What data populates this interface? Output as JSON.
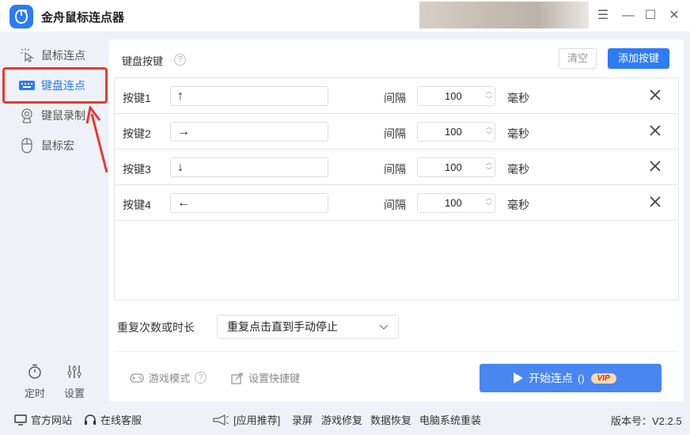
{
  "app": {
    "title": "金舟鼠标连点器"
  },
  "window_controls": {
    "menu": "☰",
    "minimize": "—",
    "maximize": "☐",
    "close": "✕"
  },
  "sidebar": {
    "items": [
      {
        "label": "鼠标连点",
        "icon": "mouse-click-icon"
      },
      {
        "label": "键盘连点",
        "icon": "keyboard-icon",
        "active": true
      },
      {
        "label": "键鼠录制",
        "icon": "webcam-icon"
      },
      {
        "label": "鼠标宏",
        "icon": "mouse-icon"
      }
    ],
    "bottom": [
      {
        "label": "定时",
        "icon": "stopwatch-icon"
      },
      {
        "label": "设置",
        "icon": "sliders-icon"
      }
    ]
  },
  "main": {
    "section_title": "键盘按键",
    "help": "?",
    "clear_label": "清空",
    "add_label": "添加按键",
    "keys": [
      {
        "label": "按键1",
        "key": "↑",
        "interval_label": "间隔",
        "interval": "100",
        "unit": "毫秒"
      },
      {
        "label": "按键2",
        "key": "→",
        "interval_label": "间隔",
        "interval": "100",
        "unit": "毫秒"
      },
      {
        "label": "按键3",
        "key": "↓",
        "interval_label": "间隔",
        "interval": "100",
        "unit": "毫秒"
      },
      {
        "label": "按键4",
        "key": "←",
        "interval_label": "间隔",
        "interval": "100",
        "unit": "毫秒"
      }
    ],
    "repeat_label": "重复次数或时长",
    "repeat_value": "重复点击直到手动停止",
    "game_mode": "游戏模式",
    "game_help": "?",
    "shortcut": "设置快捷键",
    "start_label": "开始连点",
    "start_hotkey": "()",
    "vip": "VIP"
  },
  "footer": {
    "official_site": "官方网站",
    "online_service": "在线客服",
    "recommend": "[应用推荐]",
    "links": [
      "录屏",
      "游戏修复",
      "数据恢复",
      "电脑系统重装"
    ],
    "version": "版本号：V2.2.5"
  },
  "colors": {
    "accent": "#2f7bf5",
    "highlight": "#e53935"
  }
}
